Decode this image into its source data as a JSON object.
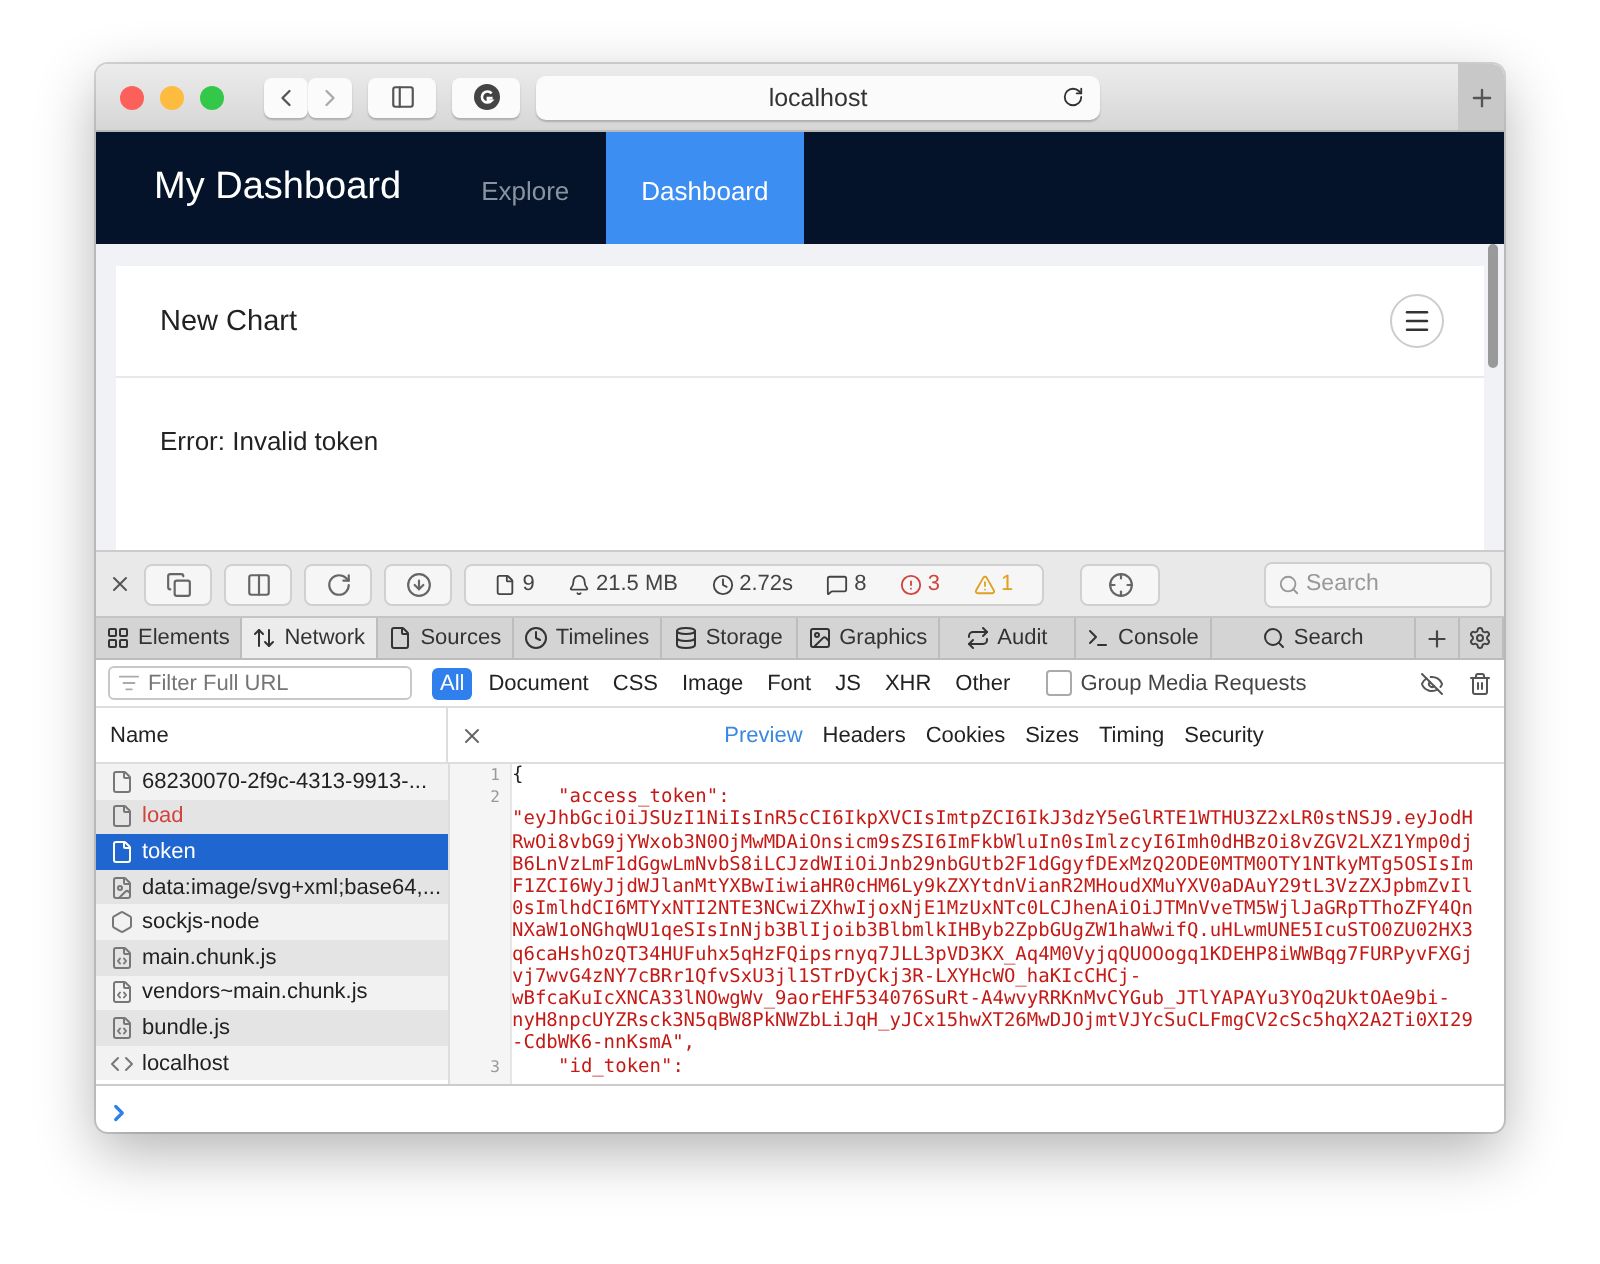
{
  "window": {
    "url": "localhost"
  },
  "navbar": {
    "brand": "My Dashboard",
    "tabs": [
      {
        "label": "Explore",
        "selected": false
      },
      {
        "label": "Dashboard",
        "selected": true
      }
    ]
  },
  "card": {
    "title": "New Chart",
    "message": "Error: Invalid token"
  },
  "devtools": {
    "summary": [
      {
        "kind": "resources",
        "text": "9"
      },
      {
        "kind": "size",
        "text": "21.5 MB"
      },
      {
        "kind": "time",
        "text": "2.72s"
      },
      {
        "kind": "logs",
        "text": "8"
      },
      {
        "kind": "errors",
        "text": "3"
      },
      {
        "kind": "warnings",
        "text": "1"
      }
    ],
    "search_placeholder": "Search",
    "tabs": [
      {
        "kind": "elements",
        "label": "Elements",
        "selected": false
      },
      {
        "kind": "network",
        "label": "Network",
        "selected": true
      },
      {
        "kind": "sources",
        "label": "Sources",
        "selected": false
      },
      {
        "kind": "timelines",
        "label": "Timelines",
        "selected": false
      },
      {
        "kind": "storage",
        "label": "Storage",
        "selected": false
      },
      {
        "kind": "graphics",
        "label": "Graphics",
        "selected": false
      },
      {
        "kind": "audit",
        "label": "Audit",
        "selected": false
      },
      {
        "kind": "console",
        "label": "Console",
        "selected": false
      },
      {
        "kind": "search",
        "label": "Search",
        "selected": false
      }
    ],
    "filter_placeholder": "Filter Full URL",
    "types": [
      {
        "label": "All",
        "selected": true
      },
      {
        "label": "Document",
        "selected": false
      },
      {
        "label": "CSS",
        "selected": false
      },
      {
        "label": "Image",
        "selected": false
      },
      {
        "label": "Font",
        "selected": false
      },
      {
        "label": "JS",
        "selected": false
      },
      {
        "label": "XHR",
        "selected": false
      },
      {
        "label": "Other",
        "selected": false
      }
    ],
    "group_media": {
      "label": "Group Media Requests",
      "checked": false
    },
    "list_header": "Name",
    "preview_tabs": [
      {
        "label": "Preview",
        "selected": true
      },
      {
        "label": "Headers",
        "selected": false
      },
      {
        "label": "Cookies",
        "selected": false
      },
      {
        "label": "Sizes",
        "selected": false
      },
      {
        "label": "Timing",
        "selected": false
      },
      {
        "label": "Security",
        "selected": false
      }
    ],
    "requests": [
      {
        "kind": "document",
        "name": "68230070-2f9c-4313-9913-...",
        "failed": false,
        "selected": false
      },
      {
        "kind": "document",
        "name": "load",
        "failed": true,
        "selected": false
      },
      {
        "kind": "document",
        "name": "token",
        "failed": false,
        "selected": true
      },
      {
        "kind": "image",
        "name": "data:image/svg+xml;base64,...",
        "failed": false,
        "selected": false
      },
      {
        "kind": "socket",
        "name": "sockjs-node",
        "failed": false,
        "selected": false
      },
      {
        "kind": "script",
        "name": "main.chunk.js",
        "failed": false,
        "selected": false
      },
      {
        "kind": "script",
        "name": "vendors~main.chunk.js",
        "failed": false,
        "selected": false
      },
      {
        "kind": "script",
        "name": "bundle.js",
        "failed": false,
        "selected": false
      },
      {
        "kind": "markup",
        "name": "localhost",
        "failed": false,
        "selected": false
      }
    ],
    "preview_lines": [
      {
        "number": "1",
        "kind": "punct",
        "text": "{"
      },
      {
        "number": "2",
        "kind": "key",
        "text": "\"access_token\":"
      },
      {
        "kind": "string",
        "text": "\"eyJhbGciOiJSUzI1NiIsInR5cCI6IkpXVCIsImtpZCI6IkJ3dzY5eGlRTE1WTHU3Z2xLR0stNSJ9.eyJodH"
      },
      {
        "kind": "string",
        "text": "RwOi8vbG9jYWxob3N0OjMwMDAiOnsicm9sZSI6ImFkbWluIn0sImlzcyI6Imh0dHBzOi8vZGV2LXZ1Ymp0dj"
      },
      {
        "kind": "string",
        "text": "B6LnVzLmF1dGgwLmNvbS8iLCJzdWIiOiJnb29nbGUtb2F1dGgyfDExMzQ2ODE0MTM0OTY1NTkyMTg5OSIsIm"
      },
      {
        "kind": "string",
        "text": "F1ZCI6WyJjdWJlanMtYXBwIiwiaHR0cHM6Ly9kZXYtdnVianR2MHoudXMuYXV0aDAuY29tL3VzZXJpbmZvIl"
      },
      {
        "kind": "string",
        "text": "0sImlhdCI6MTYxNTI2NTE3NCwiZXhwIjoxNjE1MzUxNTc0LCJhenAiOiJTMnVveTM5WjlJaGRpTThoZFY4Qn"
      },
      {
        "kind": "string",
        "text": "NXaW1oNGhqWU1qeSIsInNjb3BlIjoib3BlbmlkIHByb2ZpbGUgZW1haWwifQ.uHLwmUNE5IcuSTO0ZU02HX3"
      },
      {
        "kind": "string",
        "text": "q6caHshOzQT34HUFuhx5qHzFQipsrnyq7JLL3pVD3KX_Aq4M0VyjqQUOOogq1KDEHP8iWWBqg7FURPyvFXGj"
      },
      {
        "kind": "string",
        "text": "vj7wvG4zNY7cBRr1QfvSxU3jl1STrDyCkj3R-LXYHcWO_haKIcCHCj-"
      },
      {
        "kind": "string",
        "text": "wBfcaKuIcXNCA33lNOwgWv_9aorEHF534076SuRt-A4wvyRRKnMvCYGub_JTlYAPAYu3YOq2UktOAe9bi-"
      },
      {
        "kind": "string",
        "text": "nyH8npcUYZRsck3N5qBW8PkNWZbLiJqH_yJCx15hwXT26MwDJOjmtVJYcSuCLFmgCV2cSc5hqX2A2Ti0XI29"
      },
      {
        "kind": "string",
        "text": "-CdbWK6-nnKsmA\","
      },
      {
        "number": "3",
        "kind": "key",
        "text": "\"id_token\":"
      }
    ]
  }
}
